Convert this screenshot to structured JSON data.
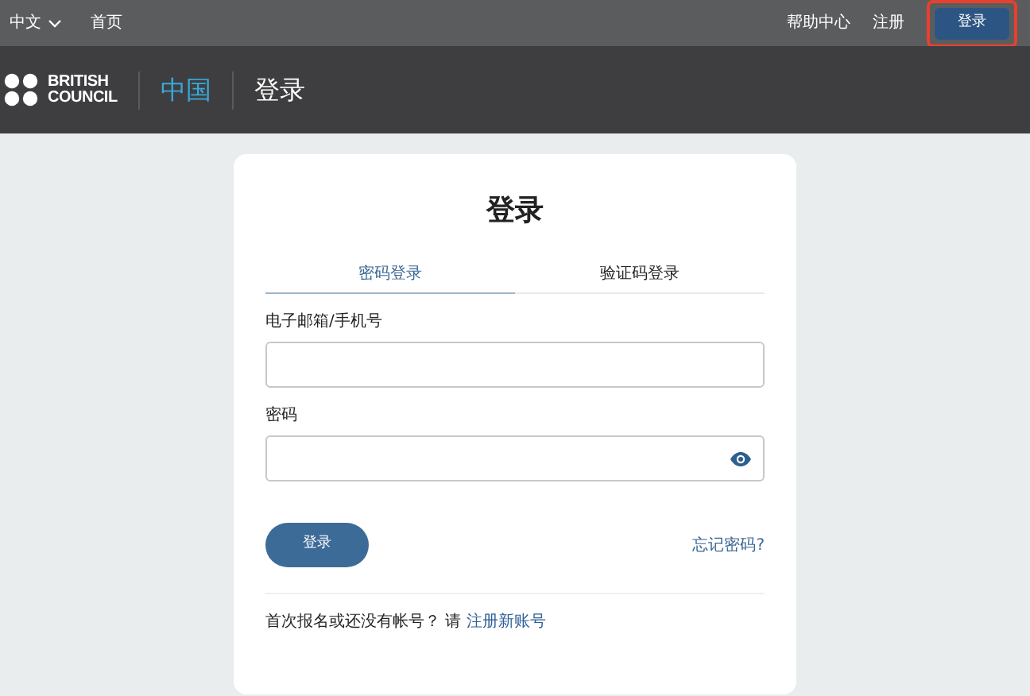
{
  "top_bar": {
    "language": "中文",
    "links": [
      {
        "label": "首页"
      }
    ],
    "right_links": [
      {
        "label": "帮助中心"
      },
      {
        "label": "注册"
      }
    ],
    "login_button": {
      "label": "登录",
      "highlighted": true
    }
  },
  "header": {
    "logo": [
      "BRITISH",
      "COUNCIL"
    ],
    "region": "中国",
    "page": "登录"
  },
  "card": {
    "title": "登录",
    "tabs": [
      {
        "label": "密码登录",
        "selected": true
      },
      {
        "label": "验证码登录",
        "selected": false
      }
    ],
    "fields": [
      {
        "label": "电子邮箱/手机号",
        "kind": "text"
      },
      {
        "label": "密码",
        "kind": "password"
      }
    ],
    "submit": "登录",
    "forgot": "忘记密码?",
    "prompt": "首次报名或还没有帐号？ 请 ",
    "signup_link": "注册新账号"
  }
}
